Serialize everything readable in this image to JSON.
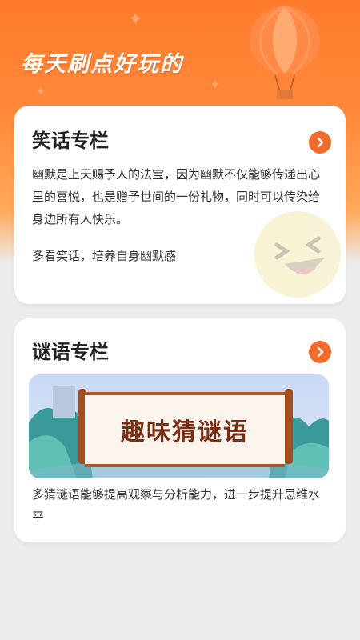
{
  "header": {
    "banner": "每天刷点好玩的"
  },
  "cards": [
    {
      "title": "笑话专栏",
      "description": "幽默是上天赐予人的法宝，因为幽默不仅能够传递出心里的喜悦，也是赠予世间的一份礼物，同时可以传染给身边所有人快乐。",
      "extra": "多看笑话，培养自身幽默感"
    },
    {
      "title": "谜语专栏",
      "banner_text": "趣味猜谜语",
      "description": "多猜谜语能够提高观察与分析能力，进一步提升思维水平"
    }
  ],
  "colors": {
    "accent": "#f26a2c",
    "header": "#ff7b2c",
    "scroll_text": "#7a2d12"
  },
  "icons": [
    "chevron-right-icon",
    "hot-air-balloon-icon",
    "laughing-emoji-icon",
    "sparkle-icon"
  ]
}
